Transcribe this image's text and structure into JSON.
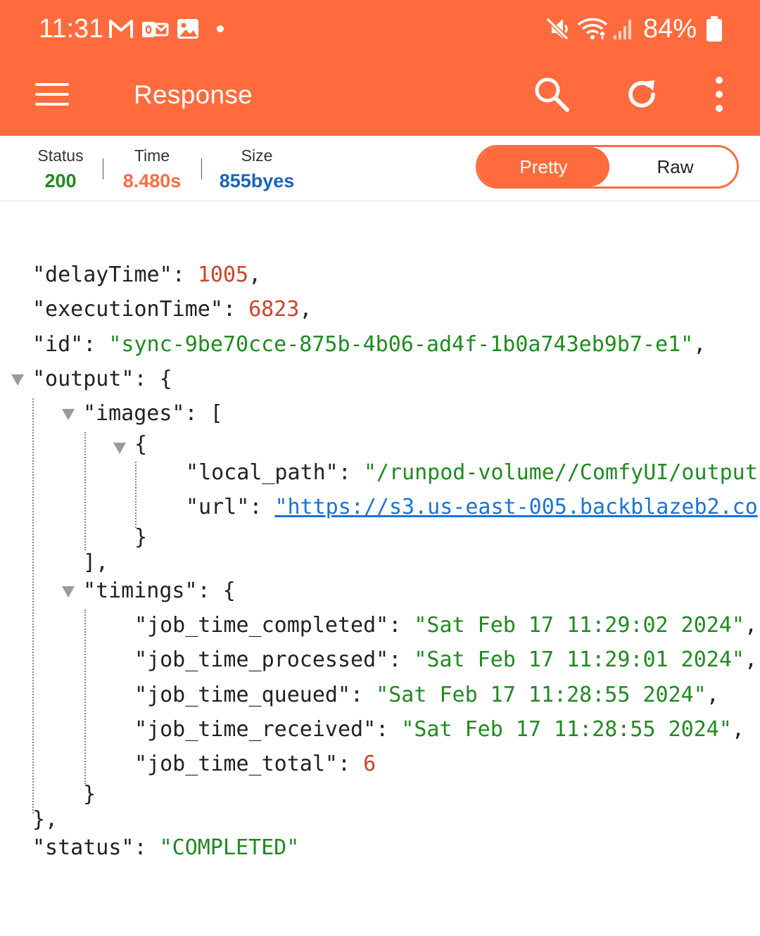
{
  "status_bar": {
    "time": "11:31",
    "battery": "84%",
    "icons": [
      "gmail-icon",
      "outlook-icon",
      "gallery-icon",
      "dot-icon",
      "mute-icon",
      "wifi-icon",
      "signal-icon",
      "battery-icon"
    ]
  },
  "app_bar": {
    "title": "Response",
    "actions": [
      "search-icon",
      "refresh-icon",
      "more-vert-icon"
    ]
  },
  "info": {
    "status_label": "Status",
    "status_value": "200",
    "time_label": "Time",
    "time_value": "8.480s",
    "size_label": "Size",
    "size_value": "855byes",
    "pretty_label": "Pretty",
    "raw_label": "Raw",
    "selected_view": "Pretty"
  },
  "json": {
    "delay_key": "\"delayTime\"",
    "delay_val": "1005",
    "exec_key": "\"executionTime\"",
    "exec_val": "6823",
    "id_key": "\"id\"",
    "id_val": "\"sync-9be70cce-875b-4b06-ad4f-1b0a743eb9b7-e1\"",
    "output_key": "\"output\"",
    "images_key": "\"images\"",
    "local_path_key": "\"local_path\"",
    "local_path_val": "\"/runpod-volume//ComfyUI/output",
    "url_key": "\"url\"",
    "url_val": "\"https://s3.us-east-005.backblazeb2.co",
    "timings_key": "\"timings\"",
    "completed_key": "\"job_time_completed\"",
    "completed_val": "\"Sat Feb 17 11:29:02 2024\"",
    "processed_key": "\"job_time_processed\"",
    "processed_val": "\"Sat Feb 17 11:29:01 2024\"",
    "queued_key": "\"job_time_queued\"",
    "queued_val": "\"Sat Feb 17 11:28:55 2024\"",
    "received_key": "\"job_time_received\"",
    "received_val": "\"Sat Feb 17 11:28:55 2024\"",
    "total_key": "\"job_time_total\"",
    "total_val": "6",
    "status_key": "\"status\"",
    "status_val": "\"COMPLETED\""
  },
  "colors": {
    "accent": "#ff6b3d",
    "status_ok": "#1e8a1e",
    "time": "#ff6b3d",
    "size": "#1565c0",
    "json_number": "#d0432a",
    "json_string": "#1f8b1f",
    "json_link": "#1a73d9"
  }
}
